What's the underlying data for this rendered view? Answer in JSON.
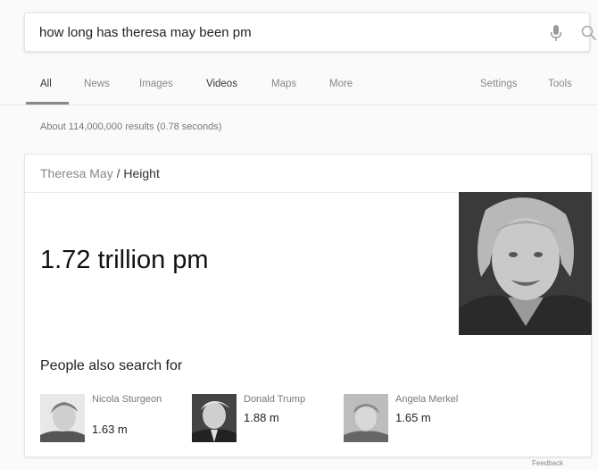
{
  "search": {
    "query": "how long has theresa may been pm",
    "mic_icon": "microphone-icon",
    "search_icon": "search-icon"
  },
  "tabs": [
    {
      "label": "All",
      "active": true
    },
    {
      "label": "News"
    },
    {
      "label": "Images"
    },
    {
      "label": "Videos"
    },
    {
      "label": "Maps"
    },
    {
      "label": "More"
    },
    {
      "label": "Settings"
    },
    {
      "label": "Tools"
    }
  ],
  "result_stats": "About 114,000,000 results (0.78 seconds)",
  "knowledge_card": {
    "subject": "Theresa May",
    "separator": "/",
    "attribute": "Height",
    "answer": "1.72 trillion pm",
    "people_also_search_title": "People also search for",
    "people": [
      {
        "name": "Nicola Sturgeon",
        "value": "1.63 m"
      },
      {
        "name": "Donald Trump",
        "value": "1.88 m"
      },
      {
        "name": "Angela Merkel",
        "value": "1.65 m"
      }
    ]
  },
  "feedback": "Feedback",
  "colors": {
    "background": "#fafafa",
    "card": "#ffffff",
    "text_primary": "#222222",
    "text_secondary": "#888888"
  }
}
